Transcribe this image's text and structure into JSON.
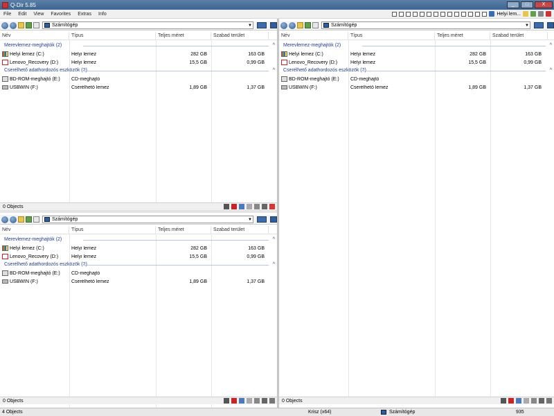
{
  "app": {
    "title": "Q-Dir 5.85"
  },
  "menu": [
    "File",
    "Edit",
    "View",
    "Favorites",
    "Extras",
    "Info"
  ],
  "toolbar": {
    "quick_label": "Helyi lem...",
    "window_controls": [
      "_",
      "□",
      "X"
    ]
  },
  "columns": [
    "Név",
    "Típus",
    "Teljes méret",
    "Szabad terület"
  ],
  "location": "Számítógép",
  "groups": [
    {
      "label": "Merevlemez-meghajtók (2)",
      "items": [
        {
          "name": "Helyi lemez (C:)",
          "type": "Helyi lemez",
          "size": "282 GB",
          "free": "163 GB",
          "icon": "windows-drive-icon"
        },
        {
          "name": "Lenovo_Recovery (D:)",
          "type": "Helyi lemez",
          "size": "15,5 GB",
          "free": "0,99 GB",
          "icon": "recovery-drive-icon"
        }
      ]
    },
    {
      "label": "Cserélhető adathordozós eszközök (2)",
      "items": [
        {
          "name": "BD-ROM-meghajtó (E:)",
          "type": "CD-meghajtó",
          "size": "",
          "free": "",
          "icon": "optical-drive-icon"
        },
        {
          "name": "USBWIN (F:)",
          "type": "Cserélhető lemez",
          "size": "1,89 GB",
          "free": "1,37 GB",
          "icon": "usb-drive-icon"
        }
      ]
    }
  ],
  "pane_status": "0 Objects",
  "bottom": {
    "objects": "4 Objects",
    "user": "Krisz (x64)",
    "location": "Számítógép",
    "size": "935"
  }
}
